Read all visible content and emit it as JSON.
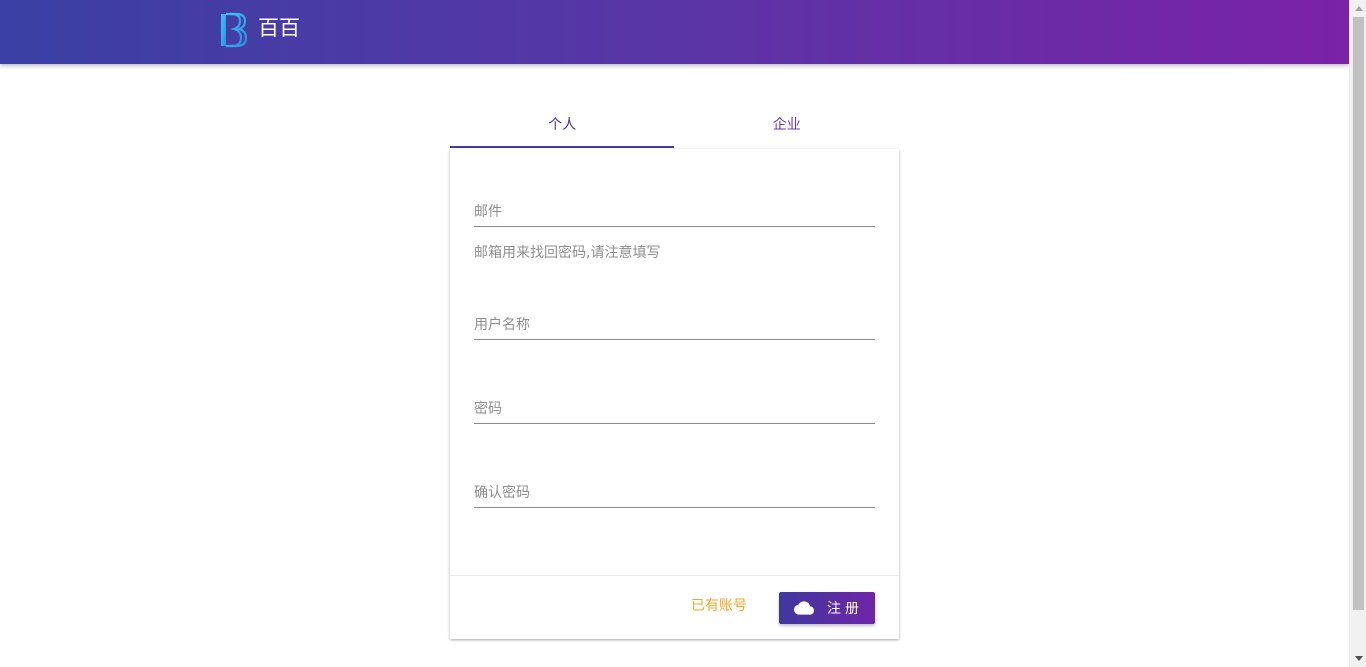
{
  "header": {
    "brand_name": "百百",
    "logo_icon": "bb-logo-icon"
  },
  "tabs": [
    {
      "label": "个人",
      "active": true
    },
    {
      "label": "企业",
      "active": false
    }
  ],
  "form": {
    "email": {
      "placeholder": "邮件",
      "value": ""
    },
    "email_hint": "邮箱用来找回密码,请注意填写",
    "username": {
      "placeholder": "用户名称",
      "value": ""
    },
    "password": {
      "placeholder": "密码",
      "value": ""
    },
    "confirm_password": {
      "placeholder": "确认密码",
      "value": ""
    }
  },
  "actions": {
    "login_link": "已有账号",
    "register_button": "注册",
    "register_icon": "cloud-icon"
  },
  "colors": {
    "header_gradient_start": "#3a40a5",
    "header_gradient_end": "#7a22a8",
    "accent": "#4a38a0",
    "link": "#f5a623"
  }
}
